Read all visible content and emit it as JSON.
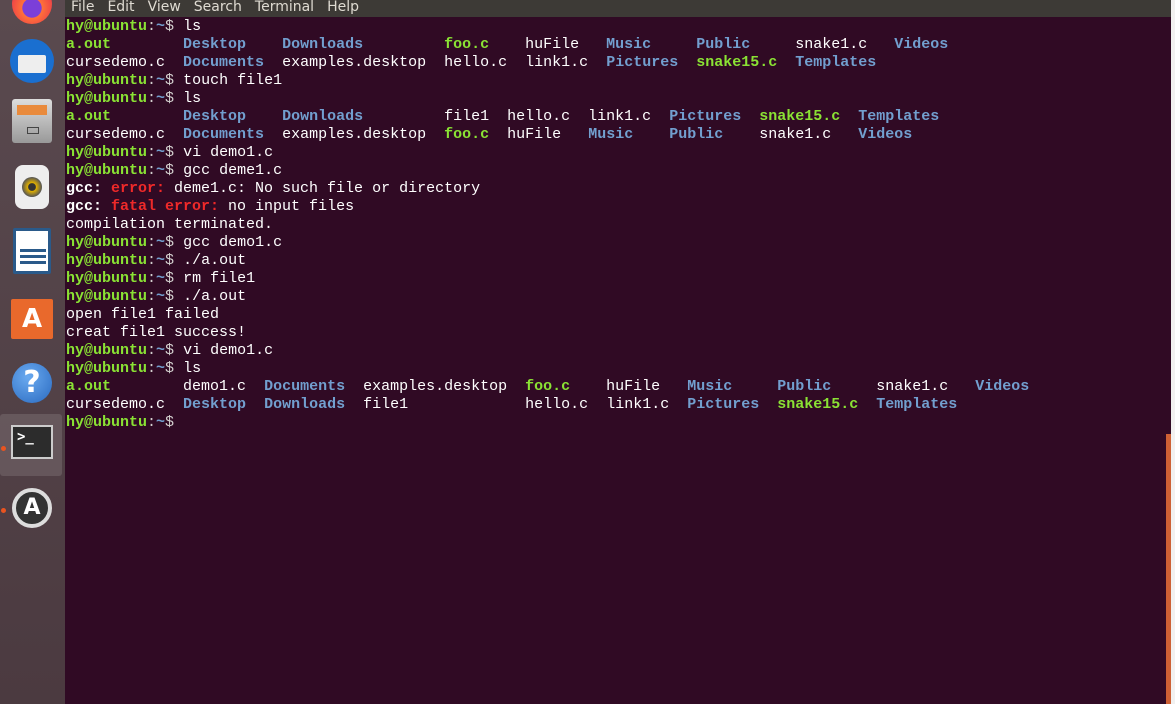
{
  "colors": {
    "background": "#300a24",
    "prompt": "#8ae234",
    "directory": "#729fcf",
    "error": "#ef2929",
    "scrollbar": "#cd6034"
  },
  "launcher": [
    {
      "name": "firefox-icon"
    },
    {
      "name": "thunderbird-icon"
    },
    {
      "name": "files-icon"
    },
    {
      "name": "rhythmbox-icon"
    },
    {
      "name": "libreoffice-writer-icon"
    },
    {
      "name": "software-center-icon"
    },
    {
      "name": "help-icon",
      "glyph": "?"
    },
    {
      "name": "terminal-icon",
      "glyph": ">_",
      "active": true
    },
    {
      "name": "software-updater-icon",
      "glyph": "A"
    }
  ],
  "menu": [
    "File",
    "Edit",
    "View",
    "Search",
    "Terminal",
    "Help"
  ],
  "prompt": {
    "user": "hy@ubuntu",
    "sep": ":",
    "dir": "~",
    "sym": "$ "
  },
  "lines": [
    {
      "cmd": "ls"
    },
    {
      "ls": [
        [
          [
            "a.out",
            "g"
          ],
          [
            "cursedemo.c",
            "w"
          ]
        ],
        [
          [
            "Desktop",
            "b"
          ],
          [
            "Documents",
            "b"
          ]
        ],
        [
          [
            "Downloads",
            "b"
          ],
          [
            "examples.desktop",
            "w"
          ]
        ],
        [
          [
            "foo.c",
            "g"
          ],
          [
            "hello.c",
            "w"
          ]
        ],
        [
          [
            "huFile",
            "w"
          ],
          [
            "link1.c",
            "w"
          ]
        ],
        [
          [
            "Music",
            "b"
          ],
          [
            "Pictures",
            "b"
          ]
        ],
        [
          [
            "Public",
            "b"
          ],
          [
            "snake15.c",
            "g"
          ]
        ],
        [
          [
            "snake1.c",
            "w"
          ],
          [
            "Templates",
            "b"
          ]
        ],
        [
          [
            "Videos",
            "b"
          ]
        ]
      ]
    },
    {
      "cmd": "touch file1"
    },
    {
      "cmd": "ls"
    },
    {
      "ls": [
        [
          [
            "a.out",
            "g"
          ],
          [
            "cursedemo.c",
            "w"
          ]
        ],
        [
          [
            "Desktop",
            "b"
          ],
          [
            "Documents",
            "b"
          ]
        ],
        [
          [
            "Downloads",
            "b"
          ],
          [
            "examples.desktop",
            "w"
          ]
        ],
        [
          [
            "file1",
            "w"
          ],
          [
            "foo.c",
            "g"
          ]
        ],
        [
          [
            "hello.c",
            "w"
          ],
          [
            "huFile",
            "w"
          ]
        ],
        [
          [
            "link1.c",
            "w"
          ],
          [
            "Music",
            "b"
          ]
        ],
        [
          [
            "Pictures",
            "b"
          ],
          [
            "Public",
            "b"
          ]
        ],
        [
          [
            "snake15.c",
            "g"
          ],
          [
            "snake1.c",
            "w"
          ]
        ],
        [
          [
            "Templates",
            "b"
          ],
          [
            "Videos",
            "b"
          ]
        ]
      ]
    },
    {
      "cmd": "vi demo1.c"
    },
    {
      "cmd": "gcc deme1.c"
    },
    {
      "seg": [
        [
          "gcc: ",
          "wb"
        ],
        [
          "error: ",
          "r"
        ],
        [
          "deme1.c: No such file or directory",
          "w"
        ]
      ]
    },
    {
      "seg": [
        [
          "gcc: ",
          "wb"
        ],
        [
          "fatal error: ",
          "r"
        ],
        [
          "no input files",
          "w"
        ]
      ]
    },
    {
      "seg": [
        [
          "compilation terminated.",
          "w"
        ]
      ]
    },
    {
      "cmd": "gcc demo1.c"
    },
    {
      "cmd": "./a.out"
    },
    {
      "cmd": "rm file1"
    },
    {
      "cmd": "./a.out"
    },
    {
      "seg": [
        [
          "open file1 failed",
          "w"
        ]
      ]
    },
    {
      "seg": [
        [
          "creat file1 success!",
          "w"
        ]
      ]
    },
    {
      "cmd": "vi demo1.c"
    },
    {
      "cmd": "ls"
    },
    {
      "ls": [
        [
          [
            "a.out",
            "g"
          ],
          [
            "cursedemo.c",
            "w"
          ]
        ],
        [
          [
            "demo1.c",
            "w"
          ],
          [
            "Desktop",
            "b"
          ]
        ],
        [
          [
            "Documents",
            "b"
          ],
          [
            "Downloads",
            "b"
          ]
        ],
        [
          [
            "examples.desktop",
            "w"
          ],
          [
            "file1",
            "w"
          ]
        ],
        [
          [
            "foo.c",
            "g"
          ],
          [
            "hello.c",
            "w"
          ]
        ],
        [
          [
            "huFile",
            "w"
          ],
          [
            "link1.c",
            "w"
          ]
        ],
        [
          [
            "Music",
            "b"
          ],
          [
            "Pictures",
            "b"
          ]
        ],
        [
          [
            "Public",
            "b"
          ],
          [
            "snake15.c",
            "g"
          ]
        ],
        [
          [
            "snake1.c",
            "w"
          ],
          [
            "Templates",
            "b"
          ]
        ],
        [
          [
            "Videos",
            "b"
          ]
        ]
      ]
    },
    {
      "cmd": ""
    }
  ]
}
